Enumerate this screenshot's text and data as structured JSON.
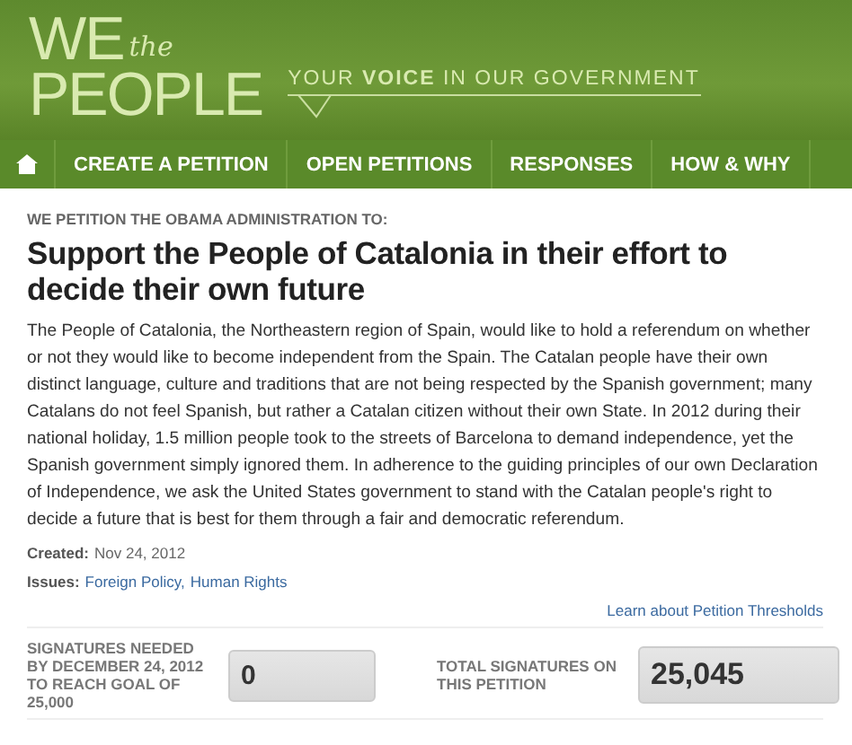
{
  "header": {
    "logo_top": "WE",
    "logo_the": "the",
    "logo_bottom": "PEOPLE",
    "tagline": "YOUR **VOICE** IN OUR GOVERNMENT"
  },
  "nav": {
    "items": [
      {
        "label": "CREATE A PETITION"
      },
      {
        "label": "OPEN PETITIONS"
      },
      {
        "label": "RESPONSES"
      },
      {
        "label": "HOW & WHY"
      }
    ]
  },
  "petition": {
    "kicker": "WE PETITION THE OBAMA ADMINISTRATION TO:",
    "title": "Support the People of Catalonia in their effort to decide their own future",
    "body": "The People of Catalonia, the Northeastern region of Spain, would like to hold a referendum on whether or not they would like to become independent from the Spain. The Catalan people have their own distinct language, culture and traditions that are not being respected by the Spanish government; many Catalans do not feel Spanish, but rather a Catalan citizen without their own State. In 2012 during their national holiday, 1.5 million people took to the streets of Barcelona to demand independence, yet the Spanish government simply ignored them. In adherence to the guiding principles of our own Declaration of Independence, we ask the United States government to stand with the Catalan people's right to decide a future that is best for them through a fair and democratic referendum.",
    "created_label": "Created:",
    "created": "Nov 24, 2012",
    "issues_label": "Issues:",
    "issues": [
      "Foreign Policy,",
      "Human Rights"
    ]
  },
  "thresholds_link": "Learn about Petition Thresholds",
  "signatures": [
    {
      "label": "SIGNATURES NEEDED BY DECEMBER 24, 2012 TO REACH GOAL OF 25,000",
      "value": "0"
    },
    {
      "label": "TOTAL SIGNATURES ON THIS PETITION",
      "value": "25,045"
    }
  ]
}
